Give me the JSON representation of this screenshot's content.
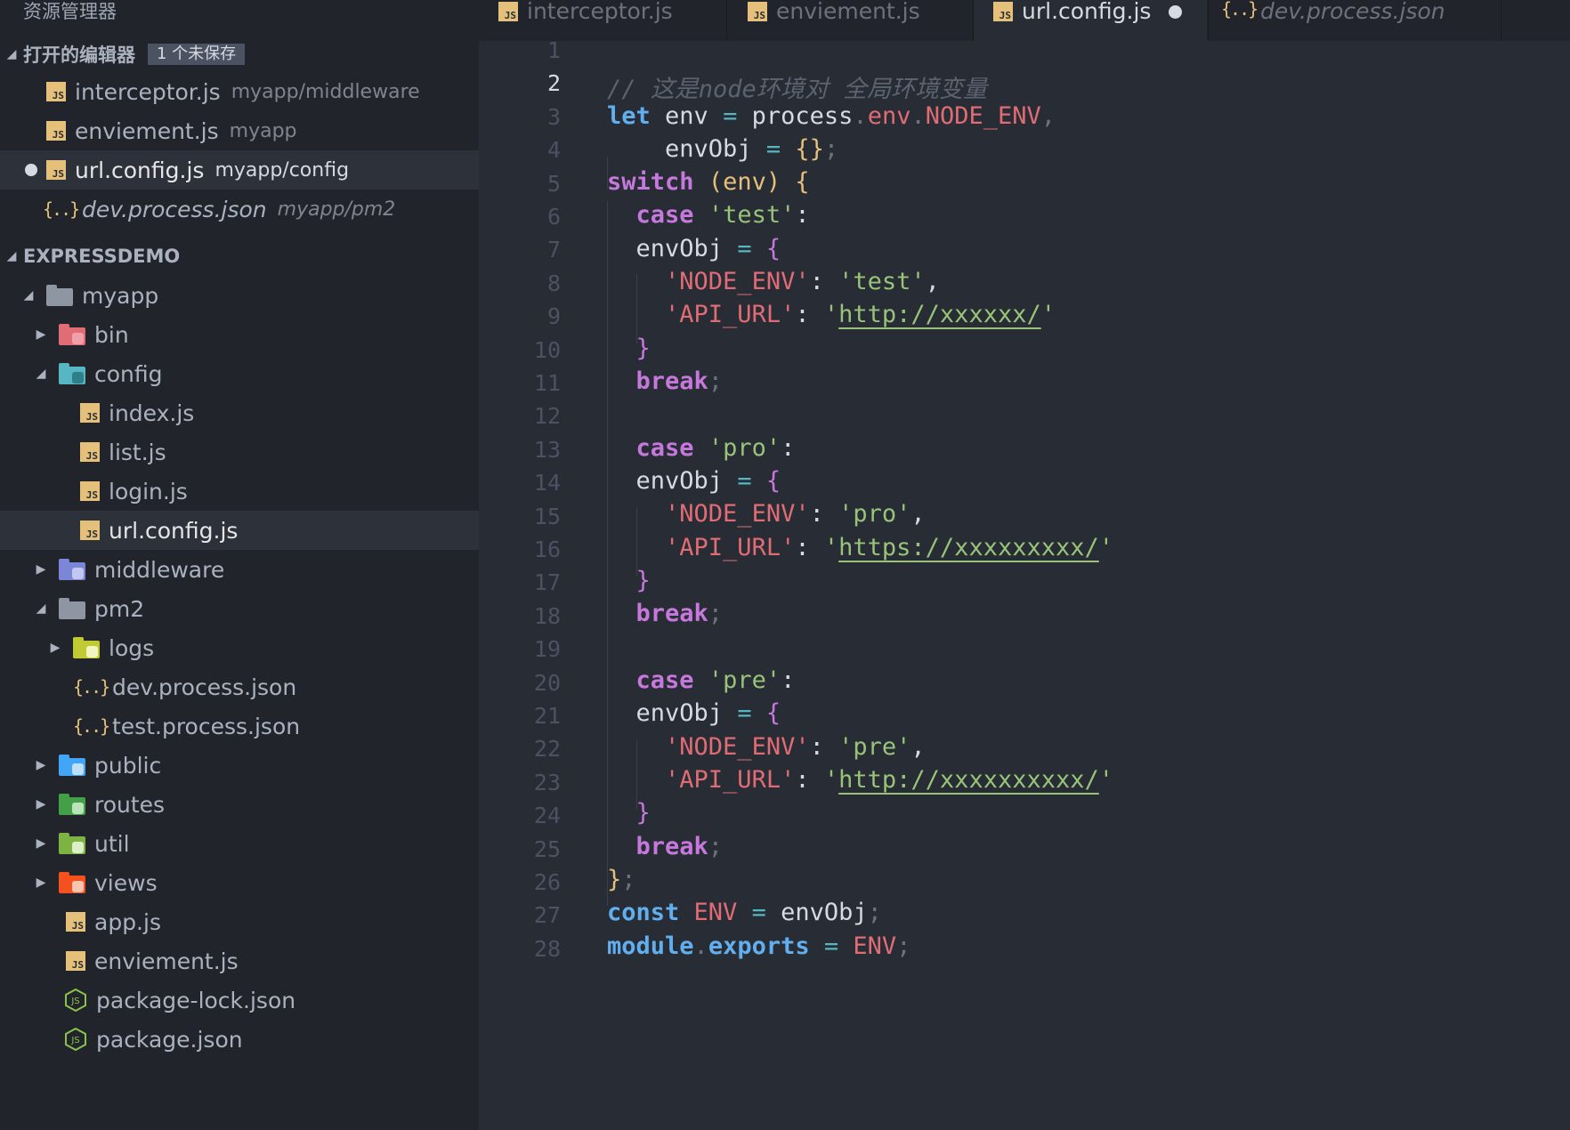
{
  "sidebar": {
    "title": "资源管理器",
    "open_editors": {
      "header": "打开的编辑器",
      "badge": "1 个未保存",
      "items": [
        {
          "label": "interceptor.js",
          "path": "myapp/middleware",
          "icon": "js-file-icon"
        },
        {
          "label": "enviement.js",
          "path": "myapp",
          "icon": "js-file-icon"
        },
        {
          "label": "url.config.js",
          "path": "myapp/config",
          "icon": "js-file-icon",
          "unsaved": true
        },
        {
          "label": "dev.process.json",
          "path": "myapp/pm2",
          "icon": "json-file-icon",
          "preview": true
        }
      ]
    },
    "project": {
      "header": "EXPRESSDEMO",
      "tree": [
        {
          "label": "myapp"
        },
        {
          "label": "bin"
        },
        {
          "label": "config"
        },
        {
          "label": "index.js"
        },
        {
          "label": "list.js"
        },
        {
          "label": "login.js"
        },
        {
          "label": "url.config.js"
        },
        {
          "label": "middleware"
        },
        {
          "label": "pm2"
        },
        {
          "label": "logs"
        },
        {
          "label": "dev.process.json"
        },
        {
          "label": "test.process.json"
        },
        {
          "label": "public"
        },
        {
          "label": "routes"
        },
        {
          "label": "util"
        },
        {
          "label": "views"
        },
        {
          "label": "app.js"
        },
        {
          "label": "enviement.js"
        },
        {
          "label": "package-lock.json"
        },
        {
          "label": "package.json"
        }
      ]
    }
  },
  "tabs": [
    {
      "label": "interceptor.js",
      "icon": "js-file-icon"
    },
    {
      "label": "enviement.js",
      "icon": "js-file-icon"
    },
    {
      "label": "url.config.js",
      "icon": "js-file-icon",
      "active": true,
      "modified": true
    },
    {
      "label": "dev.process.json",
      "icon": "json-file-icon",
      "preview": true
    }
  ],
  "editor": {
    "current_line": 2,
    "line_numbers": [
      "1",
      "2",
      "3",
      "4",
      "5",
      "6",
      "7",
      "8",
      "9",
      "10",
      "11",
      "12",
      "13",
      "14",
      "15",
      "16",
      "17",
      "18",
      "19",
      "20",
      "21",
      "22",
      "23",
      "24",
      "25",
      "26",
      "27",
      "28"
    ],
    "code": {
      "l2_comment": "// 这是node环境对 全局环境变量",
      "kw_let": "let",
      "v_env": "env",
      "op_eq": "=",
      "process": "process",
      "dot": ".",
      "p_env": "env",
      "p_node_env": "NODE_ENV",
      "comma": ",",
      "v_envobj": "envObj",
      "braces": "{}",
      "semi": ";",
      "kw_switch": "switch",
      "paren_env": "(env)",
      "lbrace": "{",
      "rbrace": "}",
      "kw_case": "case",
      "s_test": "'test'",
      "s_pro": "'pro'",
      "s_pre": "'pre'",
      "colon": ":",
      "k_node_env": "'NODE_ENV'",
      "k_api_url": "'API_URL'",
      "url_test": "http://xxxxxx/",
      "url_pro": "https://xxxxxxxxx/",
      "url_pre": "http://xxxxxxxxxx/",
      "quote": "'",
      "kw_break": "break",
      "kw_const": "const",
      "v_ENV": "ENV",
      "module": "module",
      "exports": "exports"
    }
  },
  "colors": {
    "sidebar_bg": "#21252b",
    "editor_bg": "#282c34",
    "keyword": "#c678dd",
    "string": "#98c379",
    "property": "#e06c75",
    "comment": "#5c6370",
    "js_icon": "#e5c07b"
  }
}
